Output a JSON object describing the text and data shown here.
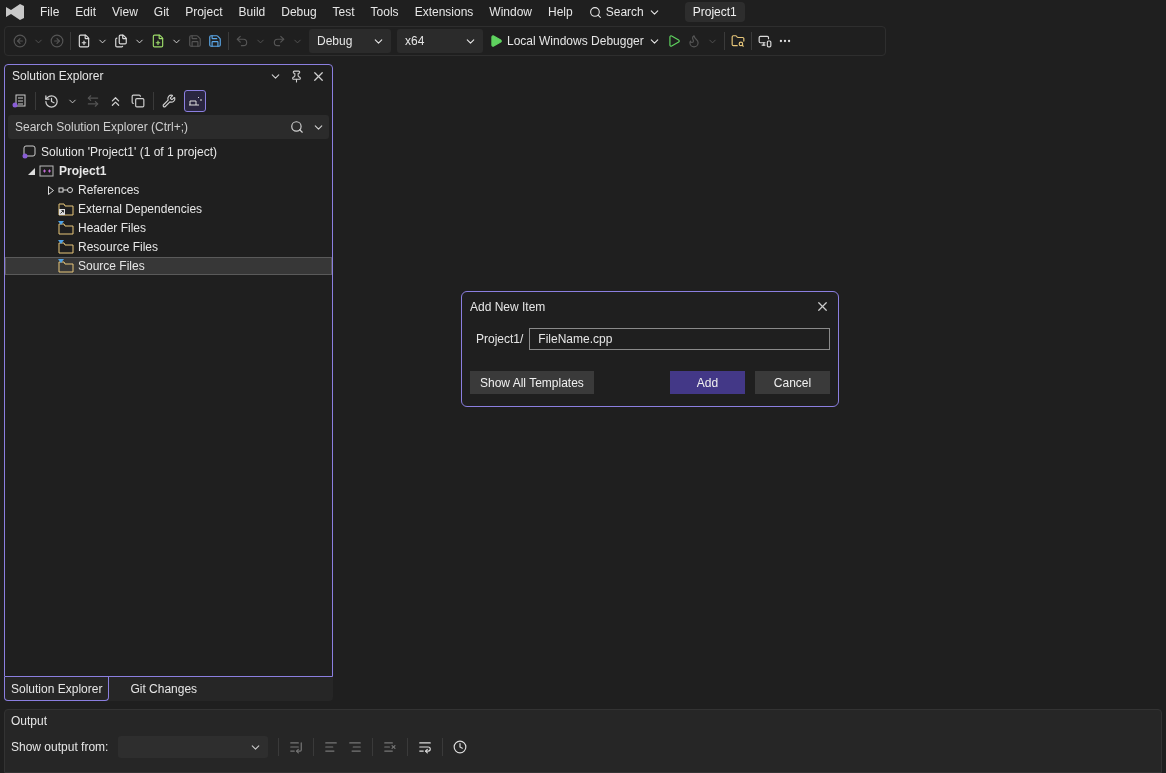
{
  "menu_bar": {
    "items": [
      "File",
      "Edit",
      "View",
      "Git",
      "Project",
      "Build",
      "Debug",
      "Test",
      "Tools",
      "Extensions",
      "Window",
      "Help"
    ],
    "search": "Search",
    "project_badge": "Project1"
  },
  "toolbar": {
    "configuration": "Debug",
    "platform": "x64",
    "debugger": "Local Windows Debugger"
  },
  "solution_explorer": {
    "title": "Solution Explorer",
    "preview_active": true,
    "search_placeholder": "Search Solution Explorer (Ctrl+;)",
    "tree": [
      {
        "kind": "solution",
        "label": "Solution 'Project1' (1 of 1 project)",
        "selected": false,
        "children": [
          {
            "kind": "project",
            "label": "Project1",
            "selected": false,
            "expanded": true,
            "children": [
              {
                "kind": "references",
                "label": "References",
                "selected": false,
                "expanded": false
              },
              {
                "kind": "external",
                "label": "External Dependencies",
                "selected": false
              },
              {
                "kind": "filter",
                "label": "Header Files",
                "selected": false
              },
              {
                "kind": "filter",
                "label": "Resource Files",
                "selected": false
              },
              {
                "kind": "filter",
                "label": "Source Files",
                "selected": true
              }
            ]
          }
        ]
      }
    ],
    "tabs": [
      {
        "label": "Solution Explorer",
        "selected": true
      },
      {
        "label": "Git Changes",
        "selected": false
      }
    ]
  },
  "dialog": {
    "title": "Add New Item",
    "path_label": "Project1/",
    "file_name": "FileName.cpp",
    "buttons": [
      {
        "kind": "secondary",
        "label": "Show All Templates"
      },
      {
        "kind": "primary",
        "label": "Add"
      },
      {
        "kind": "secondary",
        "label": "Cancel"
      }
    ]
  },
  "output": {
    "title": "Output",
    "source_label": "Show output from:"
  }
}
